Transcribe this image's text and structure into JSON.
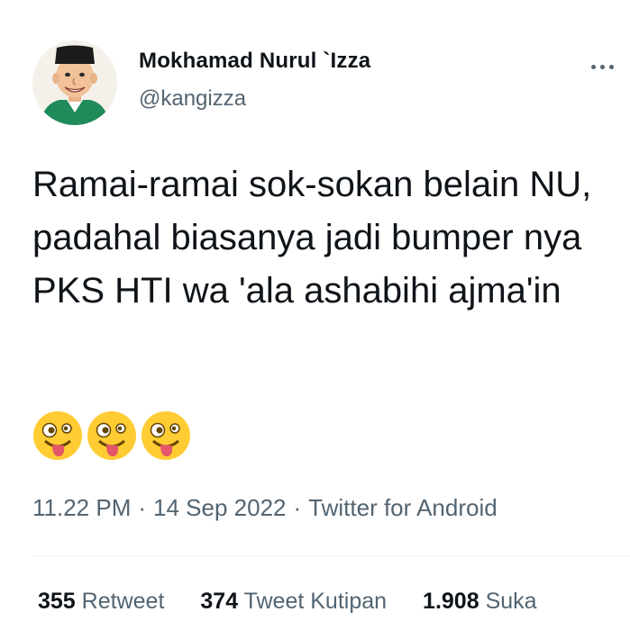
{
  "user": {
    "display_name": "Mokhamad Nurul `Izza",
    "handle": "@kangizza",
    "avatar_icon": "cartoon-avatar-icon"
  },
  "menu": {
    "icon": "more-dots-icon"
  },
  "tweet": {
    "text": "Ramai-ramai sok-sokan belain NU, padahal biasanya jadi bumper nya PKS HTI wa 'ala ashabihi ajma'in",
    "emojis": [
      "zany-face-emoji-icon",
      "zany-face-emoji-icon",
      "zany-face-emoji-icon"
    ]
  },
  "meta": {
    "time": "11.22 PM",
    "separator": "·",
    "date": "14 Sep 2022",
    "source": "Twitter for Android"
  },
  "stats": {
    "retweets_count": "355",
    "retweets_label": "Retweet",
    "quotes_count": "374",
    "quotes_label": "Tweet Kutipan",
    "likes_count": "1.908",
    "likes_label": "Suka"
  },
  "colors": {
    "text_primary": "#0f1419",
    "text_secondary": "#536471",
    "divider": "#eff3f4",
    "emoji_yellow": "#ffcc33"
  }
}
